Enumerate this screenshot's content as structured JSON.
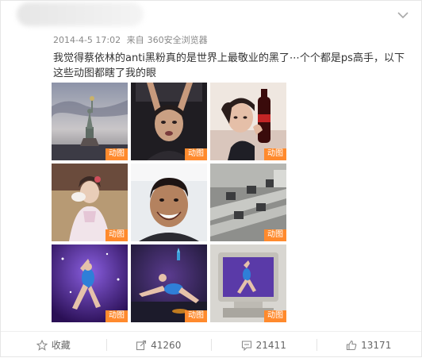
{
  "post": {
    "date": "2014-4-5 17:02",
    "source_prefix": "来自",
    "source": "360安全浏览器",
    "text": "我觉得蔡依林的anti黑粉真的是世界上最敬业的黑了⋯个个都是ps高手，以下这些动图都瞎了我的眼"
  },
  "images": [
    {
      "scene": "statue-of-liberty",
      "badge": "动图"
    },
    {
      "scene": "woman-reaching-up",
      "badge": "动图"
    },
    {
      "scene": "girl-with-cola",
      "badge": "动图"
    },
    {
      "scene": "woman-with-fan",
      "badge": "动图"
    },
    {
      "scene": "smiling-man",
      "badge": "动图"
    },
    {
      "scene": "office-desks",
      "badge": "动图"
    },
    {
      "scene": "dancer-purple-stage",
      "badge": "动图"
    },
    {
      "scene": "dancer-acrobat-stage",
      "badge": "动图"
    },
    {
      "scene": "dancer-in-monitor",
      "badge": "动图"
    }
  ],
  "actions": {
    "favorite": "收藏",
    "repost": "41260",
    "comment": "21411",
    "like": "13171"
  }
}
